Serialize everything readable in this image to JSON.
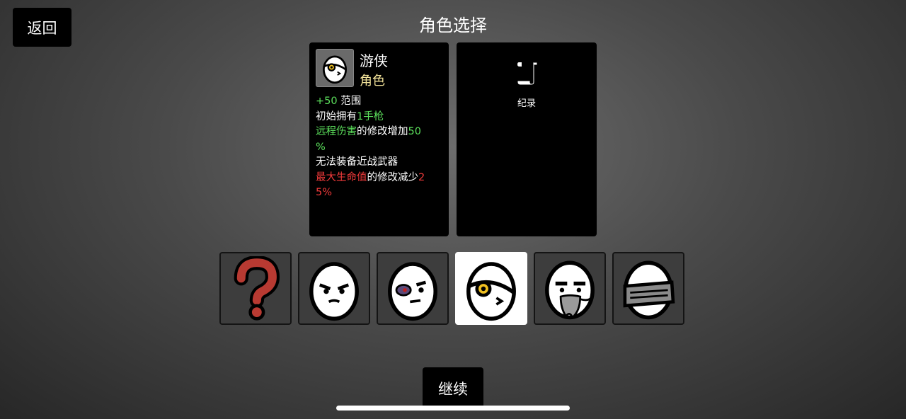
{
  "header": {
    "back_label": "返回",
    "title": "角色选择"
  },
  "character": {
    "name": "游侠",
    "type": "角色",
    "icon": "egg-eyepatch-icon"
  },
  "stats": [
    {
      "segments": [
        {
          "text": "+50",
          "color": "green"
        },
        {
          "text": " 范围",
          "color": "white"
        }
      ]
    },
    {
      "segments": [
        {
          "text": "初始拥有",
          "color": "white"
        },
        {
          "text": "1手枪",
          "color": "green"
        }
      ]
    },
    {
      "segments": [
        {
          "text": "远程伤害",
          "color": "green"
        },
        {
          "text": "的修改增加",
          "color": "white"
        },
        {
          "text": "50",
          "color": "green"
        }
      ]
    },
    {
      "segments": [
        {
          "text": "%",
          "color": "green"
        }
      ]
    },
    {
      "segments": [
        {
          "text": "无法装备近战武器",
          "color": "white"
        }
      ]
    },
    {
      "segments": [
        {
          "text": "最大生命值",
          "color": "red"
        },
        {
          "text": "的修改减少",
          "color": "white"
        },
        {
          "text": "2",
          "color": "red"
        }
      ]
    },
    {
      "segments": [
        {
          "text": "5%",
          "color": "red"
        }
      ]
    }
  ],
  "records": {
    "label": "纪录",
    "icon": "scroll-icon"
  },
  "characters": [
    {
      "id": "random",
      "icon": "question-mark-icon",
      "selected": false
    },
    {
      "id": "grumpy",
      "icon": "egg-grumpy-icon",
      "selected": false
    },
    {
      "id": "bruised",
      "icon": "egg-bruised-icon",
      "selected": false
    },
    {
      "id": "ranger",
      "icon": "egg-eyepatch-icon",
      "selected": true
    },
    {
      "id": "elder",
      "icon": "egg-bearded-icon",
      "selected": false
    },
    {
      "id": "knight",
      "icon": "egg-visor-helmet-icon",
      "selected": false
    }
  ],
  "footer": {
    "continue_label": "继续"
  },
  "colors": {
    "green": "#5ce05c",
    "red": "#f03a3a",
    "gold": "#f3e39a",
    "slot_bg": "#3d3d3d",
    "selected_bg": "#ffffff"
  }
}
